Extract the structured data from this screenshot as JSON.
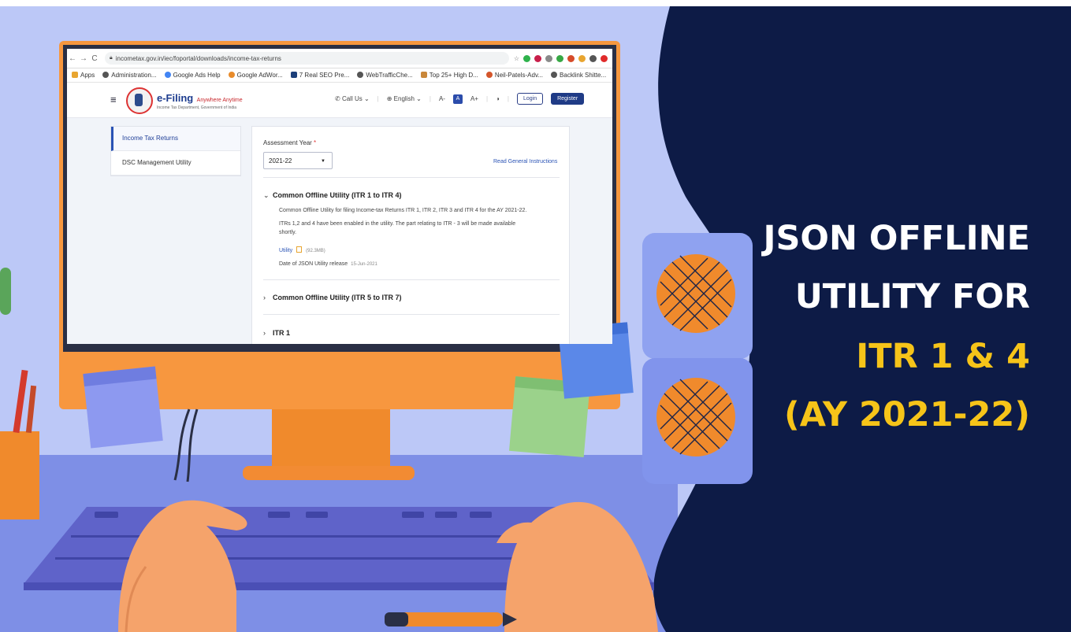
{
  "browser": {
    "url": "incometax.gov.in/iec/foportal/downloads/income-tax-returns",
    "bookmarks": [
      "Apps",
      "Administration...",
      "Google Ads Help",
      "Google AdWor...",
      "7 Real SEO Pre...",
      "WebTrafficChe...",
      "Top 25+ High D...",
      "Neil-Patels-Adv...",
      "Backlink Shitte..."
    ]
  },
  "site": {
    "logo_title": "e-Filing",
    "logo_tagline": "Anywhere Anytime",
    "logo_subtitle": "Income Tax Department, Government of India",
    "call_us": "Call Us",
    "language": "English",
    "font_small": "A-",
    "font_normal": "A",
    "font_large": "A+",
    "login": "Login",
    "register": "Register"
  },
  "sidebar": {
    "items": [
      {
        "label": "Income Tax Returns",
        "active": true
      },
      {
        "label": "DSC Management Utility",
        "active": false
      }
    ]
  },
  "main": {
    "assessment_label": "Assessment Year",
    "required_mark": "*",
    "assessment_value": "2021-22",
    "read_instructions": "Read General Instructions",
    "sections": [
      {
        "title": "Common Offline Utility (ITR 1 to ITR 4)",
        "expanded": true,
        "desc1": "Common Offline Utility for filing Income-tax Returns ITR 1, ITR 2, ITR 3 and ITR 4 for the AY 2021-22.",
        "desc2": "ITRs 1,2 and 4 have been enabled in the utility. The part relating to ITR - 3 will be made available shortly.",
        "utility_label": "Utility",
        "utility_size": "(92.3MB)",
        "release_label": "Date of JSON Utility release",
        "release_date": "15-Jun-2021"
      },
      {
        "title": "Common Offline Utility (ITR 5 to ITR 7)",
        "expanded": false
      },
      {
        "title": "ITR 1",
        "expanded": false
      }
    ]
  },
  "headline": {
    "line1": "JSON OFFLINE",
    "line2": "UTILITY FOR",
    "line3": "ITR 1 & 4",
    "line4": "(AY 2021-22)",
    "white_color": "#ffffff",
    "yellow_color": "#f6c419"
  },
  "colors": {
    "background": "#bcc8f7",
    "navy_panel": "#0d1b46",
    "monitor_frame": "#f7973f",
    "keyboard": "#6a6fd1",
    "desk": "#6e7fe0",
    "hand": "#f5a36b",
    "pattern": "#f08a2c"
  }
}
